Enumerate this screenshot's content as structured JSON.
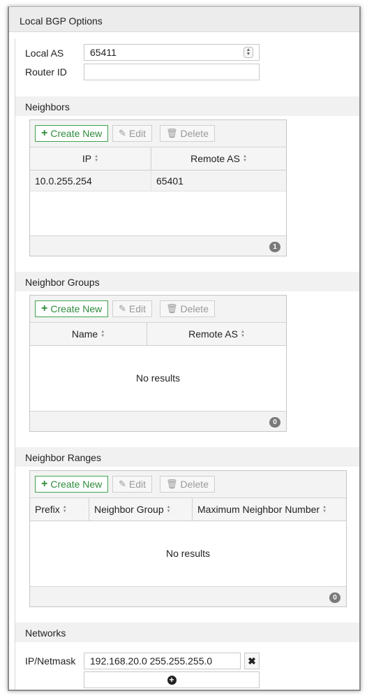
{
  "panel": {
    "title": "Local BGP Options"
  },
  "local_as": {
    "label": "Local AS",
    "value": "65411"
  },
  "router_id": {
    "label": "Router ID",
    "value": ""
  },
  "toolbar": {
    "create_label": "Create New",
    "edit_label": "Edit",
    "delete_label": "Delete"
  },
  "neighbors": {
    "title": "Neighbors",
    "columns": [
      "IP",
      "Remote AS"
    ],
    "rows": [
      {
        "ip": "10.0.255.254",
        "remote_as": "65401"
      }
    ],
    "count": "1"
  },
  "neighbor_groups": {
    "title": "Neighbor Groups",
    "columns": [
      "Name",
      "Remote AS"
    ],
    "empty_text": "No results",
    "count": "0"
  },
  "neighbor_ranges": {
    "title": "Neighbor Ranges",
    "columns": [
      "Prefix",
      "Neighbor Group",
      "Maximum Neighbor Number"
    ],
    "empty_text": "No results",
    "count": "0"
  },
  "networks": {
    "title": "Networks",
    "label": "IP/Netmask",
    "value": "192.168.20.0 255.255.255.0"
  },
  "colors": {
    "accent_green": "#2e8b3c",
    "header_bg": "#ececec",
    "badge_bg": "#7a7a7a"
  },
  "icons": [
    "plus-icon",
    "pencil-icon",
    "trash-icon",
    "sort-icon",
    "spinner-icon",
    "close-icon",
    "add-circle-icon"
  ]
}
